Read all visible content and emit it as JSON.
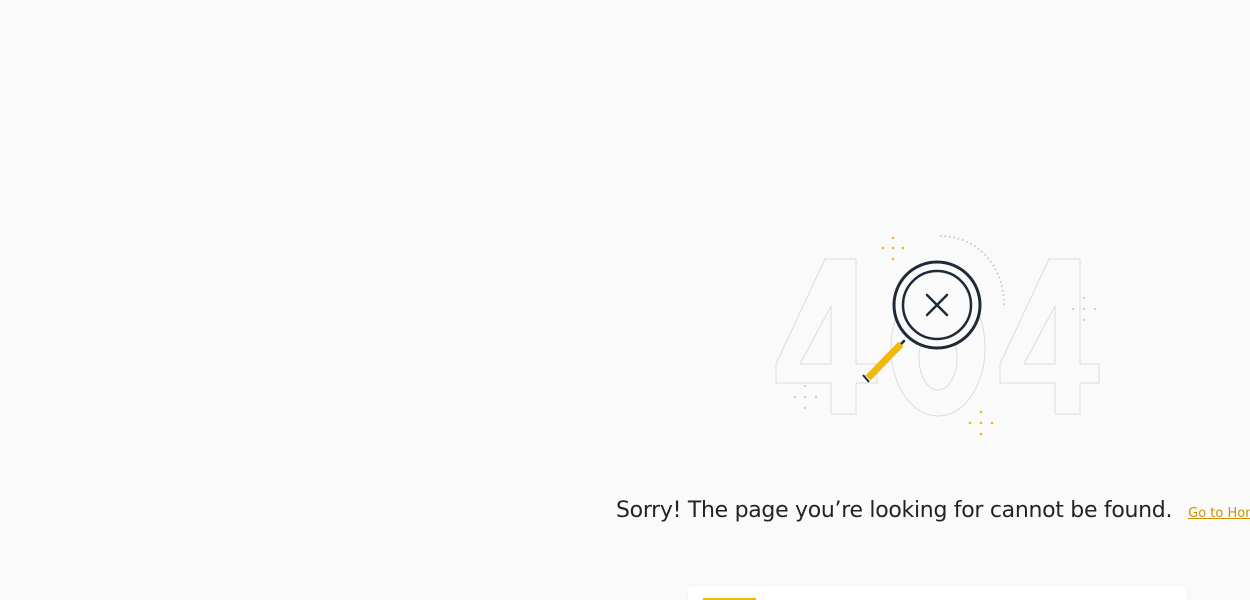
{
  "error": {
    "code": "404",
    "message": "Sorry! The page you’re looking for cannot be found.",
    "home_link_label": "Go to Homepage"
  },
  "colors": {
    "background": "#fafafa",
    "text": "#1e2329",
    "accent": "#f0b90b",
    "link": "#c99400",
    "dark_navy": "#1e2a38"
  },
  "icons": {
    "magnifier": "magnifying-glass-x-icon"
  }
}
